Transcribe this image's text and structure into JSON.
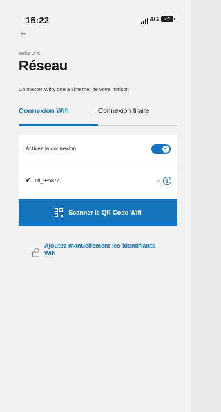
{
  "status_bar": {
    "time": "15:22",
    "network": "4G",
    "battery": "74"
  },
  "header": {
    "app_name": "Witty one",
    "title": "Réseau",
    "subtitle": "Connecter Witty one à l'internet de votre maison"
  },
  "tabs": [
    {
      "label": "Connexion Wifi",
      "active": true
    },
    {
      "label": "Connexion filaire",
      "active": false
    }
  ],
  "connection": {
    "toggle_label": "Activez la connexion",
    "toggle_on": true
  },
  "network": {
    "ssid": "ufi_985877"
  },
  "buttons": {
    "scan_label": "Scanner le QR Code Wifi",
    "manual_label": "Ajoutez manuellement les identifiants Wifi"
  },
  "colors": {
    "accent": "#1674bc",
    "background": "#f2f2f2"
  },
  "icons": [
    "back-arrow-icon",
    "signal-icon",
    "battery-icon",
    "check-icon",
    "wifi-icon",
    "info-icon",
    "qr-code-icon",
    "lock-icon"
  ]
}
